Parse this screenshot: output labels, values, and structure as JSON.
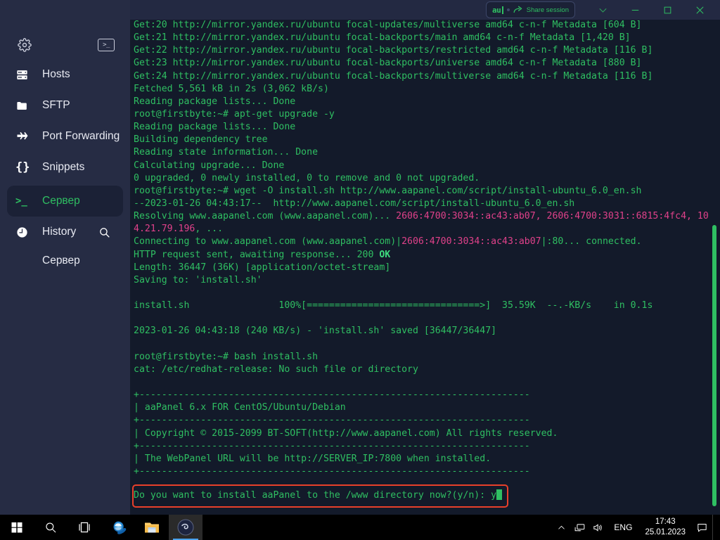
{
  "window": {
    "share_pill": {
      "session_code": "au",
      "label": "Share session",
      "share_icon": "share-arrow-icon"
    },
    "controls": {
      "chevron": "chevron-down-icon",
      "minimize": "minimize-icon",
      "maximize": "maximize-icon",
      "close": "close-icon"
    }
  },
  "sidebar": {
    "settings_icon": "gear-icon",
    "terminal_icon": "terminal-icon",
    "items": [
      {
        "label": "Hosts",
        "icon": "server-rack-icon"
      },
      {
        "label": "SFTP",
        "icon": "folder-icon"
      },
      {
        "label": "Port Forwarding",
        "icon": "port-forwarding-icon"
      },
      {
        "label": "Snippets",
        "icon": "braces-icon"
      }
    ],
    "active_session": {
      "label": "Сервер",
      "icon": "terminal-prompt-icon"
    },
    "history": {
      "label": "History",
      "icon": "clock-icon",
      "search_icon": "search-icon"
    },
    "history_entries": [
      {
        "label": "Сервер"
      }
    ]
  },
  "terminal": {
    "lines": [
      {
        "t": "Get:20 http://mirror.yandex.ru/ubuntu focal-updates/multiverse amd64 c-n-f Metadata [604 B]"
      },
      {
        "t": "Get:21 http://mirror.yandex.ru/ubuntu focal-backports/main amd64 c-n-f Metadata [1,420 B]"
      },
      {
        "t": "Get:22 http://mirror.yandex.ru/ubuntu focal-backports/restricted amd64 c-n-f Metadata [116 B]"
      },
      {
        "t": "Get:23 http://mirror.yandex.ru/ubuntu focal-backports/universe amd64 c-n-f Metadata [880 B]"
      },
      {
        "t": "Get:24 http://mirror.yandex.ru/ubuntu focal-backports/multiverse amd64 c-n-f Metadata [116 B]"
      },
      {
        "t": "Fetched 5,561 kB in 2s (3,062 kB/s)"
      },
      {
        "t": "Reading package lists... Done"
      },
      {
        "t": "root@firstbyte:~# apt-get upgrade -y"
      },
      {
        "t": "Reading package lists... Done"
      },
      {
        "t": "Building dependency tree"
      },
      {
        "t": "Reading state information... Done"
      },
      {
        "t": "Calculating upgrade... Done"
      },
      {
        "t": "0 upgraded, 0 newly installed, 0 to remove and 0 not upgraded."
      },
      {
        "t": "root@firstbyte:~# wget -O install.sh http://www.aapanel.com/script/install-ubuntu_6.0_en.sh"
      },
      {
        "t": "--2023-01-26 04:43:17--  http://www.aapanel.com/script/install-ubuntu_6.0_en.sh"
      },
      {
        "t": "Resolving www.aapanel.com (www.aapanel.com)... ",
        "t2": "2606:4700:3034::ac43:ab07, 2606:4700:3031::6815:4fc4, 10",
        "c2": "magenta"
      },
      {
        "t": "",
        "t2": "4.21.79.196",
        "c2": "magenta",
        "t3": ", ..."
      },
      {
        "t": "Connecting to www.aapanel.com (www.aapanel.com)|",
        "t2": "2606:4700:3034::ac43:ab07",
        "c2": "magenta",
        "t3": "|:80... connected."
      },
      {
        "t": "HTTP request sent, awaiting response... 200 ",
        "t2": "OK",
        "c2": "bold"
      },
      {
        "t": "Length: 36447 (36K) [application/octet-stream]"
      },
      {
        "t": "Saving to: 'install.sh'"
      },
      {
        "t": ""
      },
      {
        "t": "install.sh                100%[===============================>]  35.59K  --.-KB/s    in 0.1s"
      },
      {
        "t": ""
      },
      {
        "t": "2023-01-26 04:43:18 (240 KB/s) - 'install.sh' saved [36447/36447]"
      },
      {
        "t": ""
      },
      {
        "t": "root@firstbyte:~# bash install.sh"
      },
      {
        "t": "cat: /etc/redhat-release: No such file or directory"
      },
      {
        "t": ""
      },
      {
        "t": "+----------------------------------------------------------------------"
      },
      {
        "t": "| aaPanel 6.x FOR CentOS/Ubuntu/Debian"
      },
      {
        "t": "+----------------------------------------------------------------------"
      },
      {
        "t": "| Copyright © 2015-2099 BT-SOFT(http://www.aapanel.com) All rights reserved."
      },
      {
        "t": "+----------------------------------------------------------------------"
      },
      {
        "t": "| The WebPanel URL will be http://SERVER_IP:7800 when installed."
      },
      {
        "t": "+----------------------------------------------------------------------"
      },
      {
        "t": ""
      }
    ],
    "prompt": {
      "text": "Do you want to install aaPanel to the /www directory now?(y/n): y",
      "highlight_color": "#e8402a",
      "cursor": "block-cursor"
    },
    "scrollbar_color": "#2fbf62"
  },
  "taskbar": {
    "start": "windows-start-icon",
    "search": "search-icon",
    "task_view": "task-view-icon",
    "apps": [
      {
        "name": "internet-explorer-icon"
      },
      {
        "name": "file-explorer-icon"
      },
      {
        "name": "termius-icon",
        "active": true
      }
    ],
    "tray": {
      "overflow": "chevron-up-icon",
      "network": "network-icon",
      "volume": "volume-icon",
      "language": "ENG"
    },
    "clock": {
      "time": "17:43",
      "date": "25.01.2023"
    },
    "notifications": "notification-icon"
  }
}
